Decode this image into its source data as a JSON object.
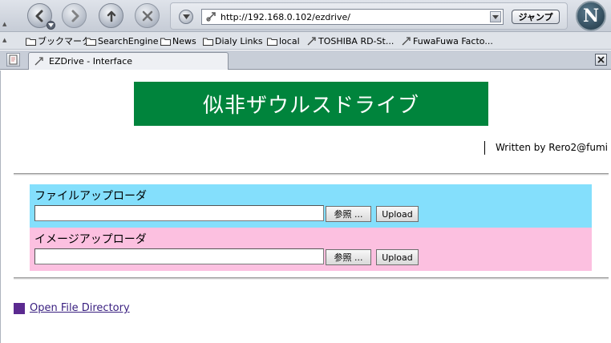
{
  "toolbar": {
    "url": "http://192.168.0.102/ezdrive/",
    "go_label": "ジャンプ",
    "throbber_letter": "N"
  },
  "bookmarks": [
    {
      "label": "ブックマーク",
      "icon": "folder-icon"
    },
    {
      "label": "SearchEngine",
      "icon": "folder-icon"
    },
    {
      "label": "News",
      "icon": "folder-icon"
    },
    {
      "label": "Dialy Links",
      "icon": "folder-icon"
    },
    {
      "label": "local",
      "icon": "folder-icon"
    },
    {
      "label": "TOSHIBA RD-St...",
      "icon": "bookmark-icon"
    },
    {
      "label": "FuwaFuwa Facto...",
      "icon": "bookmark-icon"
    }
  ],
  "tab": {
    "title": "EZDrive - Interface"
  },
  "page": {
    "title": "似非ザウルスドライブ",
    "author": "Written by Rero2@fumi",
    "title_color": "#00843c",
    "file_uploader": {
      "label": "ファイルアップローダ",
      "browse_label": "参照 ...",
      "upload_label": "Upload",
      "bg_color": "#84dffc"
    },
    "image_uploader": {
      "label": "イメージアップローダ",
      "browse_label": "参照 ...",
      "upload_label": "Upload",
      "bg_color": "#fcc0e0"
    },
    "open_dir_label": "Open File Directory"
  }
}
